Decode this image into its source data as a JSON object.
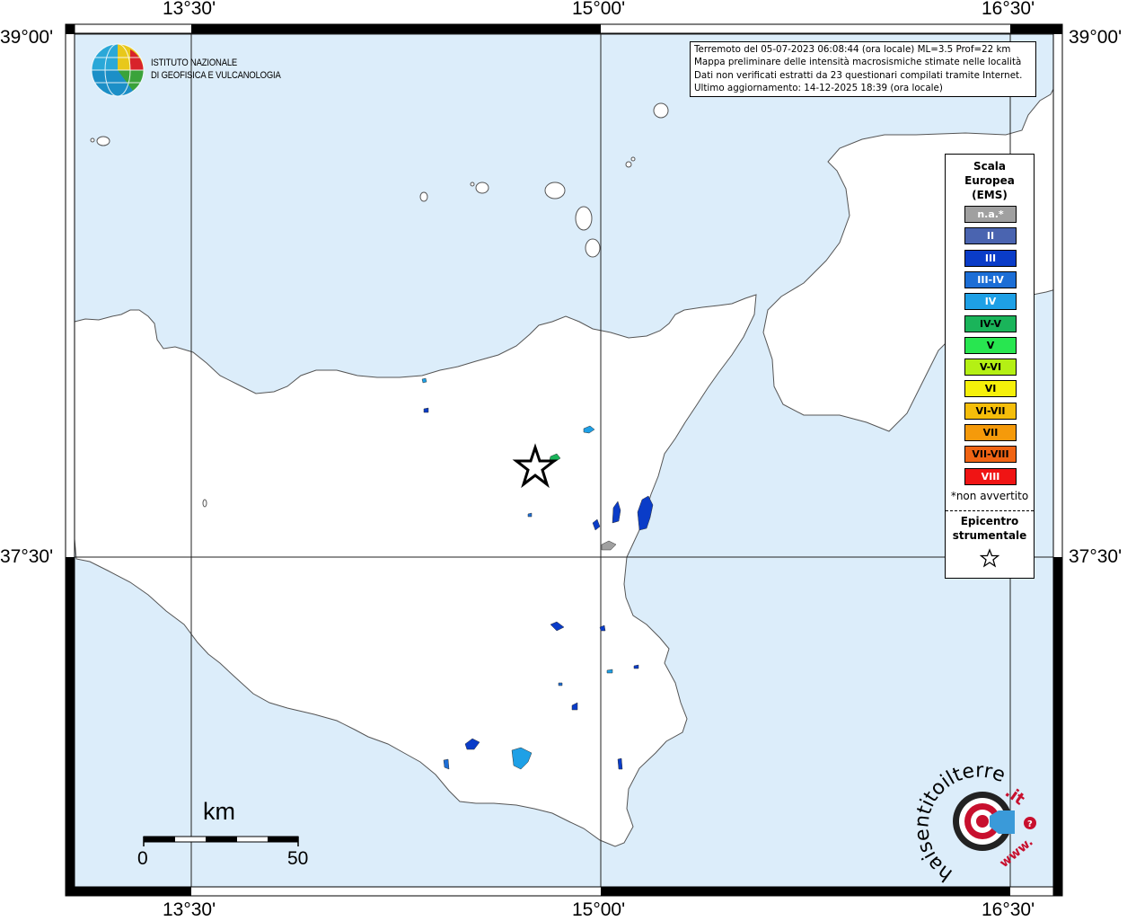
{
  "map": {
    "longitude_labels": [
      "13°30'",
      "15°00'",
      "16°30'"
    ],
    "latitude_labels": [
      "39°00'",
      "37°30'"
    ],
    "colors": {
      "sea": "#dcedfa",
      "land": "#ffffff",
      "frame": "#000000"
    }
  },
  "institute": {
    "line1": "ISTITUTO NAZIONALE",
    "line2": "DI GEOFISICA E VULCANOLOGIA",
    "logo_icon": "globe-icon"
  },
  "event_info": {
    "line1": "Terremoto del 05-07-2023 06:08:44 (ora locale) ML=3.5 Prof=22 km",
    "line2": "Mappa preliminare delle intensità macrosismiche stimate nelle località",
    "line3": "Dati non verificati estratti da 23 questionari compilati tramite Internet.",
    "line4": "Ultimo aggiornamento: 14-12-2025 18:39 (ora locale)"
  },
  "legend": {
    "title_line1": "Scala",
    "title_line2": "Europea",
    "title_line3": "(EMS)",
    "items": [
      {
        "label": "n.a.*",
        "color": "#a0a0a0",
        "text_color": "#ffffff"
      },
      {
        "label": "II",
        "color": "#4a64b0",
        "text_color": "#ffffff"
      },
      {
        "label": "III",
        "color": "#0a3cc8",
        "text_color": "#ffffff"
      },
      {
        "label": "III-IV",
        "color": "#1c6ed6",
        "text_color": "#ffffff"
      },
      {
        "label": "IV",
        "color": "#1ea0e6",
        "text_color": "#ffffff"
      },
      {
        "label": "IV-V",
        "color": "#1ab45a",
        "text_color": "#000000"
      },
      {
        "label": "V",
        "color": "#28e650",
        "text_color": "#000000"
      },
      {
        "label": "V-VI",
        "color": "#b4f014",
        "text_color": "#000000"
      },
      {
        "label": "VI",
        "color": "#f5f00a",
        "text_color": "#000000"
      },
      {
        "label": "VI-VII",
        "color": "#f5be0a",
        "text_color": "#000000"
      },
      {
        "label": "VII",
        "color": "#f59a0a",
        "text_color": "#000000"
      },
      {
        "label": "VII-VIII",
        "color": "#f06414",
        "text_color": "#000000"
      },
      {
        "label": "VIII",
        "color": "#f01414",
        "text_color": "#ffffff"
      }
    ],
    "note": "*non avvertito",
    "epicenter_line1": "Epicentro",
    "epicenter_line2": "strumentale",
    "epicenter_icon": "star-icon"
  },
  "scale_bar": {
    "unit": "km",
    "min_label": "0",
    "max_label": "50"
  },
  "brand": {
    "text_main": "haisentitoilterremoto",
    "text_tld": ".it",
    "text_www": "www.",
    "icon": "speaker-icon"
  },
  "intensity_spots": [
    {
      "place": "spot-north-coast",
      "color": "#1ea0e6"
    },
    {
      "place": "spot-inland-north",
      "color": "#0a3cc8"
    },
    {
      "place": "spot-near-epicenter-east",
      "color": "#1ab45a"
    },
    {
      "place": "spot-east-inland",
      "color": "#1ea0e6"
    },
    {
      "place": "spot-catania-north",
      "color": "#0a3cc8"
    },
    {
      "place": "spot-catania",
      "color": "#0a3cc8"
    },
    {
      "place": "spot-catania-west",
      "color": "#0a3cc8"
    },
    {
      "place": "spot-catania-south-na",
      "color": "#a0a0a0"
    },
    {
      "place": "spot-south-1",
      "color": "#0a3cc8"
    },
    {
      "place": "spot-southeast",
      "color": "#0a3cc8"
    },
    {
      "place": "spot-ragusa",
      "color": "#1ea0e6"
    },
    {
      "place": "spot-vittoria",
      "color": "#0a3cc8"
    },
    {
      "place": "spot-west-small",
      "color": "#1c6ed6"
    }
  ]
}
